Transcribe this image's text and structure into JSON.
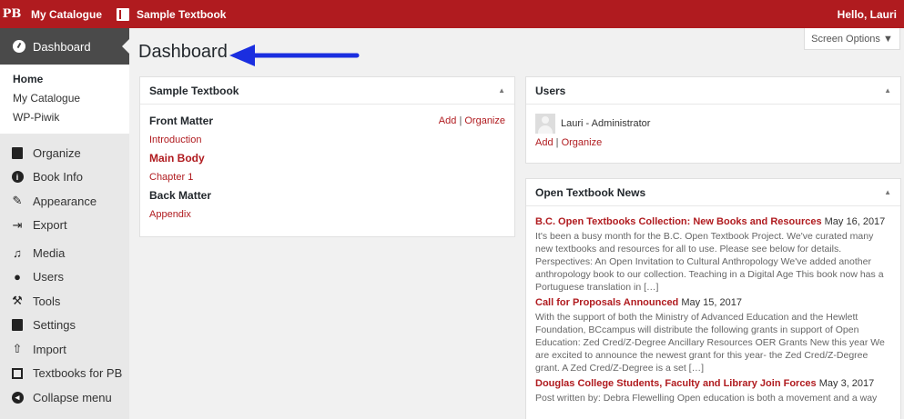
{
  "adminbar": {
    "logo": "PB",
    "my_catalogue": "My Catalogue",
    "book": "Sample Textbook",
    "hello": "Hello, Lauri"
  },
  "sidebar": {
    "dashboard": "Dashboard",
    "submenu": [
      "Home",
      "My Catalogue",
      "WP-Piwik"
    ],
    "items": [
      {
        "label": "Organize",
        "icon": "book-icon"
      },
      {
        "label": "Book Info",
        "icon": "info-icon"
      },
      {
        "label": "Appearance",
        "icon": "brush-icon"
      },
      {
        "label": "Export",
        "icon": "export-icon"
      },
      {
        "label": "Media",
        "icon": "media-icon"
      },
      {
        "label": "Users",
        "icon": "users-icon"
      },
      {
        "label": "Tools",
        "icon": "wrench-icon"
      },
      {
        "label": "Settings",
        "icon": "settings-icon"
      },
      {
        "label": "Import",
        "icon": "import-icon"
      },
      {
        "label": "Textbooks for PB",
        "icon": "textbooks-icon"
      },
      {
        "label": "Collapse menu",
        "icon": "collapse-icon"
      }
    ]
  },
  "main": {
    "title": "Dashboard",
    "screen_options": "Screen Options ▼"
  },
  "textbook_box": {
    "title": "Sample Textbook",
    "front_matter": "Front Matter",
    "add": "Add",
    "sep": "|",
    "organize": "Organize",
    "introduction": "Introduction",
    "main_body": "Main Body",
    "chapter1": "Chapter 1",
    "back_matter": "Back Matter",
    "appendix": "Appendix"
  },
  "users_box": {
    "title": "Users",
    "user": "Lauri - Administrator",
    "add": "Add",
    "sep": "|",
    "organize": "Organize"
  },
  "news_box": {
    "title": "Open Textbook News",
    "items": [
      {
        "title": "B.C. Open Textbooks Collection: New Books and Resources",
        "date": "May 16, 2017",
        "text": "It's been a busy month for the B.C. Open Textbook Project. We've curated many new textbooks and resources for all to use. Please see below for details. Perspectives: An Open Invitation to Cultural Anthropology We've added another anthropology book to our collection. Teaching in a Digital Age This book now has a Portuguese translation in […]"
      },
      {
        "title": "Call for Proposals Announced",
        "date": "May 15, 2017",
        "text": "With the support of both the Ministry of Advanced Education and the Hewlett Foundation, BCcampus will distribute the following grants in support of Open Education: Zed Cred/Z-Degree Ancillary Resources OER Grants New this year We are excited to announce the newest grant for this year- the Zed Cred/Z-Degree grant. A Zed Cred/Z-Degree is a set […]"
      },
      {
        "title": "Douglas College Students, Faculty and Library Join Forces",
        "date": "May 3, 2017",
        "text": "Post written by: Debra Flewelling Open education is both a movement and a way"
      }
    ]
  },
  "colors": {
    "brand": "#b01b1f",
    "annotation_arrow": "#1a2ee0"
  }
}
